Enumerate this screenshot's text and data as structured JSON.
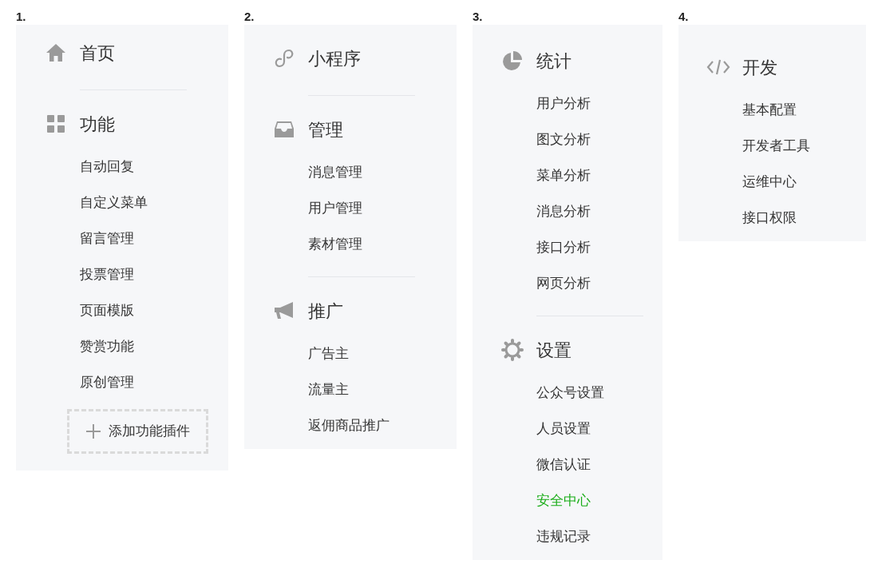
{
  "panels": [
    {
      "number": "1.",
      "sections": [
        {
          "kind": "home",
          "title": "首页"
        },
        {
          "kind": "grid",
          "title": "功能",
          "items": [
            {
              "label": "自动回复",
              "selected": false
            },
            {
              "label": "自定义菜单",
              "selected": false
            },
            {
              "label": "留言管理",
              "selected": false
            },
            {
              "label": "投票管理",
              "selected": false
            },
            {
              "label": "页面模版",
              "selected": false
            },
            {
              "label": "赞赏功能",
              "selected": false
            },
            {
              "label": "原创管理",
              "selected": false
            }
          ]
        }
      ],
      "add_button": {
        "label": "添加功能插件"
      }
    },
    {
      "number": "2.",
      "sections": [
        {
          "kind": "link",
          "title": "小程序"
        },
        {
          "kind": "inbox",
          "title": "管理",
          "items": [
            {
              "label": "消息管理",
              "selected": false
            },
            {
              "label": "用户管理",
              "selected": false
            },
            {
              "label": "素材管理",
              "selected": false
            }
          ]
        },
        {
          "kind": "megaphone",
          "title": "推广",
          "items": [
            {
              "label": "广告主",
              "selected": false
            },
            {
              "label": "流量主",
              "selected": false
            },
            {
              "label": "返佣商品推广",
              "selected": false
            }
          ]
        }
      ]
    },
    {
      "number": "3.",
      "sections": [
        {
          "kind": "pie",
          "title": "统计",
          "items": [
            {
              "label": "用户分析",
              "selected": false
            },
            {
              "label": "图文分析",
              "selected": false
            },
            {
              "label": "菜单分析",
              "selected": false
            },
            {
              "label": "消息分析",
              "selected": false
            },
            {
              "label": "接口分析",
              "selected": false
            },
            {
              "label": "网页分析",
              "selected": false
            }
          ]
        },
        {
          "kind": "gear",
          "title": "设置",
          "items": [
            {
              "label": "公众号设置",
              "selected": false
            },
            {
              "label": "人员设置",
              "selected": false
            },
            {
              "label": "微信认证",
              "selected": false
            },
            {
              "label": "安全中心",
              "selected": true
            },
            {
              "label": "违规记录",
              "selected": false
            }
          ]
        }
      ]
    },
    {
      "number": "4.",
      "sections": [
        {
          "kind": "code",
          "title": "开发",
          "items": [
            {
              "label": "基本配置",
              "selected": false
            },
            {
              "label": "开发者工具",
              "selected": false
            },
            {
              "label": "运维中心",
              "selected": false
            },
            {
              "label": "接口权限",
              "selected": false
            }
          ]
        }
      ]
    }
  ]
}
